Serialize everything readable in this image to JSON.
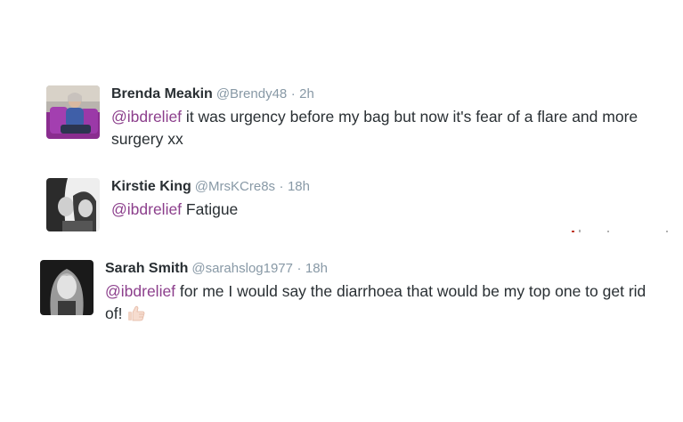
{
  "tweets": [
    {
      "name": "Brenda Meakin",
      "handle": "@Brendy48",
      "separator": "·",
      "time": "2h",
      "mention": "@ibdrelief",
      "text_line1": " it was urgency before my bag but now it's fear of a flare and more",
      "text_line2": "surgery xx"
    },
    {
      "name": "Kirstie King",
      "handle": "@MrsKCre8s",
      "separator": "·",
      "time": "18h",
      "mention": "@ibdrelief",
      "text_line1": " Fatigue"
    },
    {
      "name": "Sarah Smith",
      "handle": "@sarahslog1977",
      "separator": "·",
      "time": "18h",
      "mention": "@ibdrelief",
      "text_line1": " for me I would say the diarrhoea that would be my top one to get rid",
      "text_line2": "of!",
      "emoji": "thumbs-up-icon"
    }
  ],
  "colors": {
    "name": "#292f33",
    "meta": "#8899a6",
    "mention": "#8c3f8c",
    "text": "#292f33"
  }
}
